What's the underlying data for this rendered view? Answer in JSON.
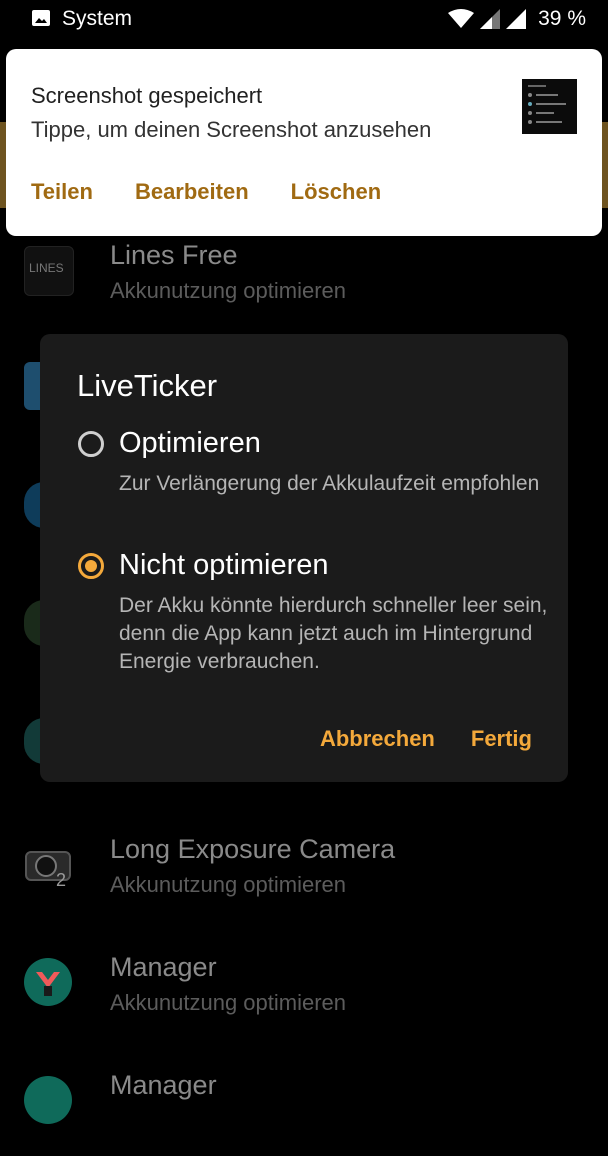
{
  "status_bar": {
    "source": "System",
    "battery": "39 %",
    "icons": [
      "image-icon",
      "wifi-icon",
      "signal-icon",
      "signal-icon-2"
    ]
  },
  "notification": {
    "title": "Screenshot gespeichert",
    "text": "Tippe, um deinen Screenshot anzusehen",
    "actions": [
      "Teilen",
      "Bearbeiten",
      "Löschen"
    ],
    "accent": "#a06a12"
  },
  "background_apps": [
    {
      "name": "Lines Free",
      "status": "Akkunutzung optimieren",
      "icon": "lines-free-icon"
    },
    {
      "name": "Long Exposure Camera",
      "status": "Akkunutzung optimieren",
      "icon": "camera-icon"
    },
    {
      "name": "Manager",
      "status": "Akkunutzung optimieren",
      "icon": "manager-icon"
    },
    {
      "name": "Manager",
      "status": "",
      "icon": "manager-icon-2"
    }
  ],
  "dialog": {
    "title": "LiveTicker",
    "options": [
      {
        "label": "Optimieren",
        "description": "Zur Verlängerung der Akkulaufzeit empfohlen",
        "selected": false
      },
      {
        "label": "Nicht optimieren",
        "description": "Der Akku könnte hierdurch schneller leer sein, denn die App kann jetzt auch im Hintergrund Energie verbrauchen.",
        "selected": true
      }
    ],
    "cancel_label": "Abbrechen",
    "done_label": "Fertig",
    "accent": "#f4a93b"
  }
}
